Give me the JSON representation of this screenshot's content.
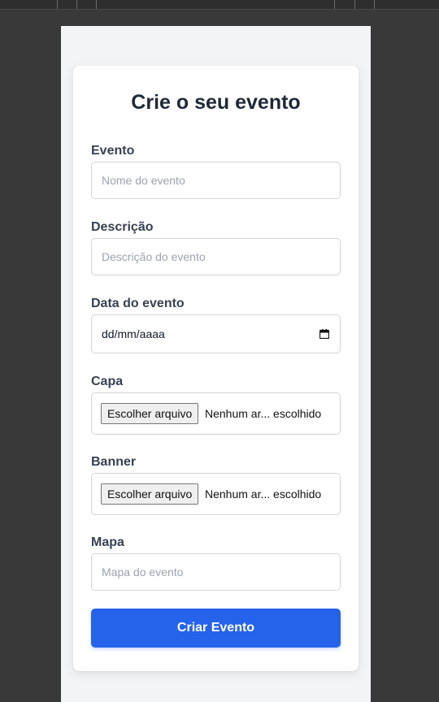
{
  "form": {
    "title": "Crie o seu evento",
    "evento": {
      "label": "Evento",
      "placeholder": "Nome do evento"
    },
    "descricao": {
      "label": "Descrição",
      "placeholder": "Descrição do evento"
    },
    "data": {
      "label": "Data do evento",
      "format_text": "dd/mm/aaaa",
      "icon": "calendar-icon"
    },
    "capa": {
      "label": "Capa",
      "button_label": "Escolher arquivo",
      "status": "Nenhum ar... escolhido"
    },
    "banner": {
      "label": "Banner",
      "button_label": "Escolher arquivo",
      "status": "Nenhum ar... escolhido"
    },
    "mapa": {
      "label": "Mapa",
      "placeholder": "Mapa do evento"
    },
    "submit_label": "Criar Evento"
  },
  "colors": {
    "primary": "#2563eb",
    "page_bg": "#f3f4f6",
    "card_bg": "#ffffff",
    "title": "#1f2937",
    "label": "#374151",
    "placeholder": "#9ca3af",
    "border": "#d1d5db"
  }
}
